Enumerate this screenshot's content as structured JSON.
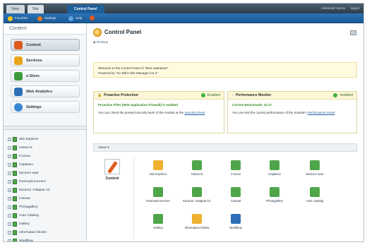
{
  "topbar": {
    "tabs": [
      "View",
      "Site",
      "Control Panel"
    ],
    "right_links": [
      "Aleksandr Ivanov",
      "logout"
    ]
  },
  "toolbar": {
    "items": [
      {
        "label": "Favorites",
        "icon": "star-icon",
        "color": "#f5c518"
      },
      {
        "label": "Settings",
        "icon": "gear-icon",
        "color": "#e67a22"
      },
      {
        "label": "Help",
        "icon": "help-icon",
        "color": "#5aa6e0"
      }
    ]
  },
  "sidebar": {
    "title": "Content",
    "modules": [
      {
        "label": "Content",
        "icon": "content-icon",
        "color": "#e05a1e"
      },
      {
        "label": "Services",
        "icon": "services-icon",
        "color": "#e8a316"
      },
      {
        "label": "e-Store",
        "icon": "estore-icon",
        "color": "#3c9a3c"
      },
      {
        "label": "Web Analytics",
        "icon": "analytics-icon",
        "color": "#2c6fb7"
      },
      {
        "label": "Settings",
        "icon": "settings-icon",
        "color": "#3a87d6"
      }
    ],
    "tree": [
      "Site Explorer",
      "Новости",
      "Статьи",
      "Сервисы",
      "Каталог книг",
      "Платный контент",
      "Каталог товаров 1С",
      "Списки",
      "Photogallery",
      "Auto Catalog",
      "Gallery",
      "Information blocks",
      "Workflow"
    ]
  },
  "main": {
    "title": "Control Panel",
    "breadcrumb": "Desktop",
    "welcome_line1": "Welcome to the Control Panel of \"Мое компания\".",
    "welcome_line2": "Powered by \"1C-Bitrix Site Manager 6.5.4\".",
    "protection": {
      "title": "Proactive Protection",
      "status": "Enabled",
      "headline": "Proactive Filter (Web Application Firewall) is enabled",
      "text": "You can check the present security level of the module at the",
      "link": "Security Panel"
    },
    "monitor": {
      "title": "Performance Monitor",
      "status": "Installed",
      "headline": "Current Benchmark: 10.17",
      "text": "You can test the current performance of the module's",
      "link": "Performance Panel"
    },
    "views_label": "Views",
    "content_label": "Content",
    "grid": [
      {
        "label": "Site Explorer",
        "icon": "site-explorer-icon",
        "color": "#f0b030"
      },
      {
        "label": "Новости",
        "icon": "news-icon",
        "color": "#4fa64a"
      },
      {
        "label": "Статьи",
        "icon": "articles-icon",
        "color": "#4fa64a"
      },
      {
        "label": "Сервисы",
        "icon": "services-icon",
        "color": "#4fa64a"
      },
      {
        "label": "Каталог книг",
        "icon": "book-catalog-icon",
        "color": "#4fa64a"
      },
      {
        "label": "Платный контент",
        "icon": "paid-content-icon",
        "color": "#4fa64a"
      },
      {
        "label": "Каталог товаров 1С",
        "icon": "products-icon",
        "color": "#4fa64a"
      },
      {
        "label": "Списки",
        "icon": "lists-icon",
        "color": "#4fa64a"
      },
      {
        "label": "Photogallery",
        "icon": "photogallery-icon",
        "color": "#4fa64a"
      },
      {
        "label": "Auto Catalog",
        "icon": "auto-catalog-icon",
        "color": "#4fa64a"
      },
      {
        "label": "Gallery",
        "icon": "gallery-icon",
        "color": "#4fa64a"
      },
      {
        "label": "Information blocks",
        "icon": "iblocks-icon",
        "color": "#f0b030"
      },
      {
        "label": "Workflow",
        "icon": "workflow-icon",
        "color": "#2c6fb7"
      }
    ]
  }
}
